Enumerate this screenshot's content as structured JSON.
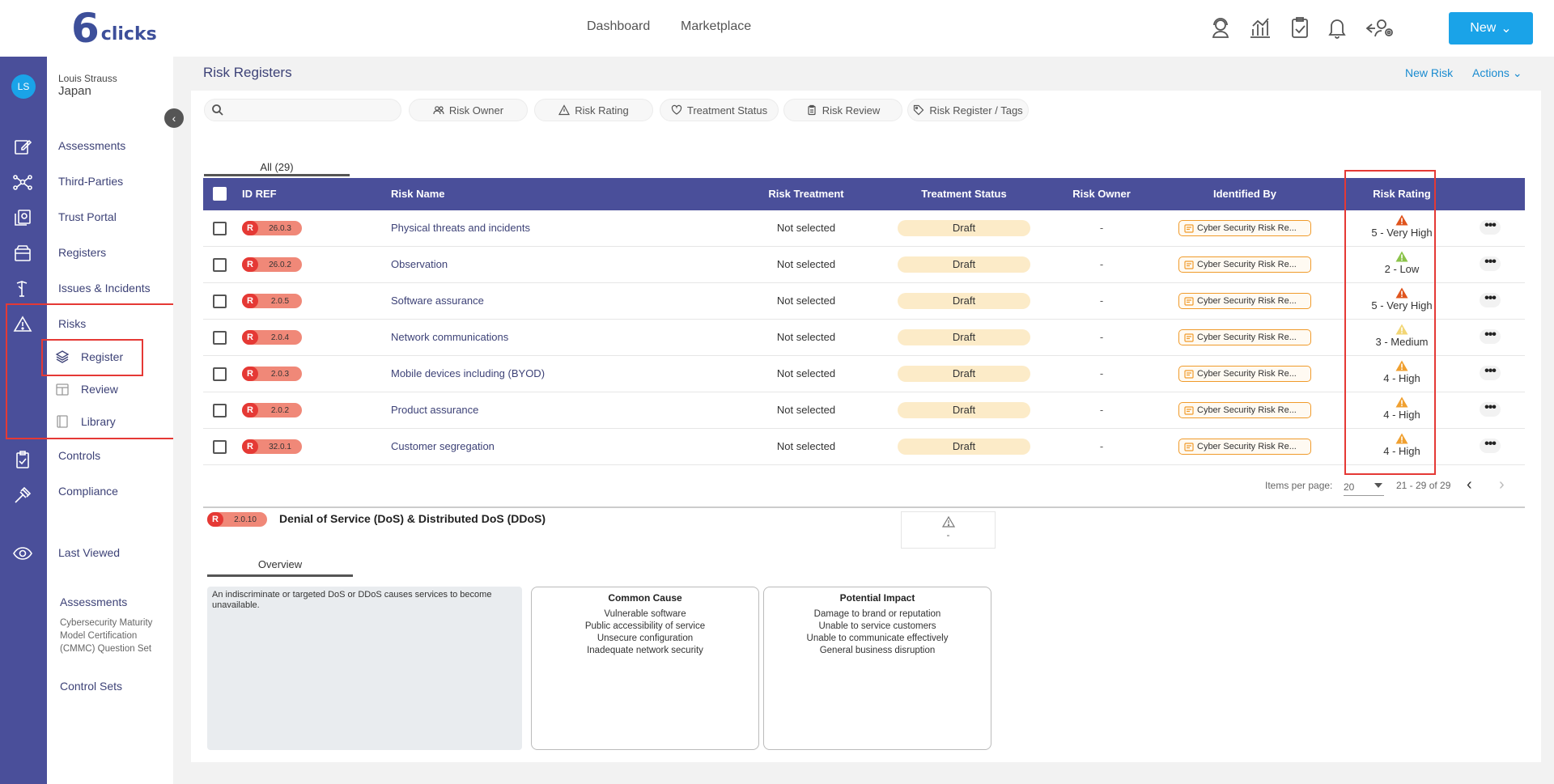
{
  "brand": {
    "logo_mark": "6",
    "logo_text": "clicks"
  },
  "topnav": {
    "dashboard": "Dashboard",
    "marketplace": "Marketplace",
    "new_button": "New"
  },
  "user": {
    "initials": "LS",
    "name": "Louis Strauss",
    "org": "Japan"
  },
  "menu": {
    "assessments": "Assessments",
    "third_parties": "Third-Parties",
    "trust_portal": "Trust Portal",
    "registers": "Registers",
    "issues": "Issues & Incidents",
    "risks": "Risks",
    "register": "Register",
    "review": "Review",
    "library": "Library",
    "controls": "Controls",
    "compliance": "Compliance",
    "last_viewed": "Last Viewed"
  },
  "last_viewed": {
    "assessments_title": "Assessments",
    "assessments_item": "Cybersecurity Maturity Model Certification (CMMC) Question Set",
    "control_sets_title": "Control Sets"
  },
  "page": {
    "title": "Risk Registers",
    "new_risk": "New Risk",
    "actions": "Actions"
  },
  "search": {
    "placeholder": ""
  },
  "filters": [
    "Risk Owner",
    "Risk Rating",
    "Treatment Status",
    "Risk Review",
    "Risk Register / Tags"
  ],
  "tabs": {
    "all": "All (29)"
  },
  "table": {
    "headers": {
      "id": "ID REF",
      "name": "Risk Name",
      "treatment": "Risk Treatment",
      "status": "Treatment Status",
      "owner": "Risk Owner",
      "identified": "Identified By",
      "rating": "Risk Rating"
    },
    "rows": [
      {
        "badge": "R",
        "id": "26.0.3",
        "name": "Physical threats and incidents",
        "treatment": "Not selected",
        "status": "Draft",
        "owner": "-",
        "identified": "Cyber Security Risk Re...",
        "rating": "5 - Very High",
        "rating_color": "#e0541d"
      },
      {
        "badge": "R",
        "id": "26.0.2",
        "name": "Observation",
        "treatment": "Not selected",
        "status": "Draft",
        "owner": "-",
        "identified": "Cyber Security Risk Re...",
        "rating": "2 - Low",
        "rating_color": "#8bc34a"
      },
      {
        "badge": "R",
        "id": "2.0.5",
        "name": "Software assurance",
        "treatment": "Not selected",
        "status": "Draft",
        "owner": "-",
        "identified": "Cyber Security Risk Re...",
        "rating": "5 - Very High",
        "rating_color": "#e0541d"
      },
      {
        "badge": "R",
        "id": "2.0.4",
        "name": "Network communications",
        "treatment": "Not selected",
        "status": "Draft",
        "owner": "-",
        "identified": "Cyber Security Risk Re...",
        "rating": "3 - Medium",
        "rating_color": "#f2d675"
      },
      {
        "badge": "R",
        "id": "2.0.3",
        "name": "Mobile devices including (BYOD)",
        "treatment": "Not selected",
        "status": "Draft",
        "owner": "-",
        "identified": "Cyber Security Risk Re...",
        "rating": "4 - High",
        "rating_color": "#f0a030"
      },
      {
        "badge": "R",
        "id": "2.0.2",
        "name": "Product assurance",
        "treatment": "Not selected",
        "status": "Draft",
        "owner": "-",
        "identified": "Cyber Security Risk Re...",
        "rating": "4 - High",
        "rating_color": "#f0a030"
      },
      {
        "badge": "R",
        "id": "32.0.1",
        "name": "Customer segregation",
        "treatment": "Not selected",
        "status": "Draft",
        "owner": "-",
        "identified": "Cyber Security Risk Re...",
        "rating": "4 - High",
        "rating_color": "#f0a030"
      }
    ],
    "more_label": "•••"
  },
  "pager": {
    "label": "Items per page:",
    "per_page": "20",
    "range": "21 - 29 of 29",
    "prev": "‹",
    "next": "›"
  },
  "detail": {
    "badge": "R",
    "id": "2.0.10",
    "title": "Denial of Service (DoS) & Distributed DoS (DDoS)",
    "rating": "-",
    "tab": "Overview",
    "description": "An indiscriminate or targeted DoS or DDoS causes services to become unavailable.",
    "common_cause_title": "Common Cause",
    "common_cause": [
      "Vulnerable software",
      "Public accessibility of service",
      "Unsecure configuration",
      "Inadequate network security"
    ],
    "impact_title": "Potential Impact",
    "impact": [
      "Damage to brand or reputation",
      "Unable to service customers",
      "Unable to communicate effectively",
      "General business disruption"
    ]
  },
  "colors": {
    "accent": "#1aa3e8",
    "nav": "#4a4f9a",
    "highlight": "#e53935",
    "draft": "#fcebc8"
  }
}
